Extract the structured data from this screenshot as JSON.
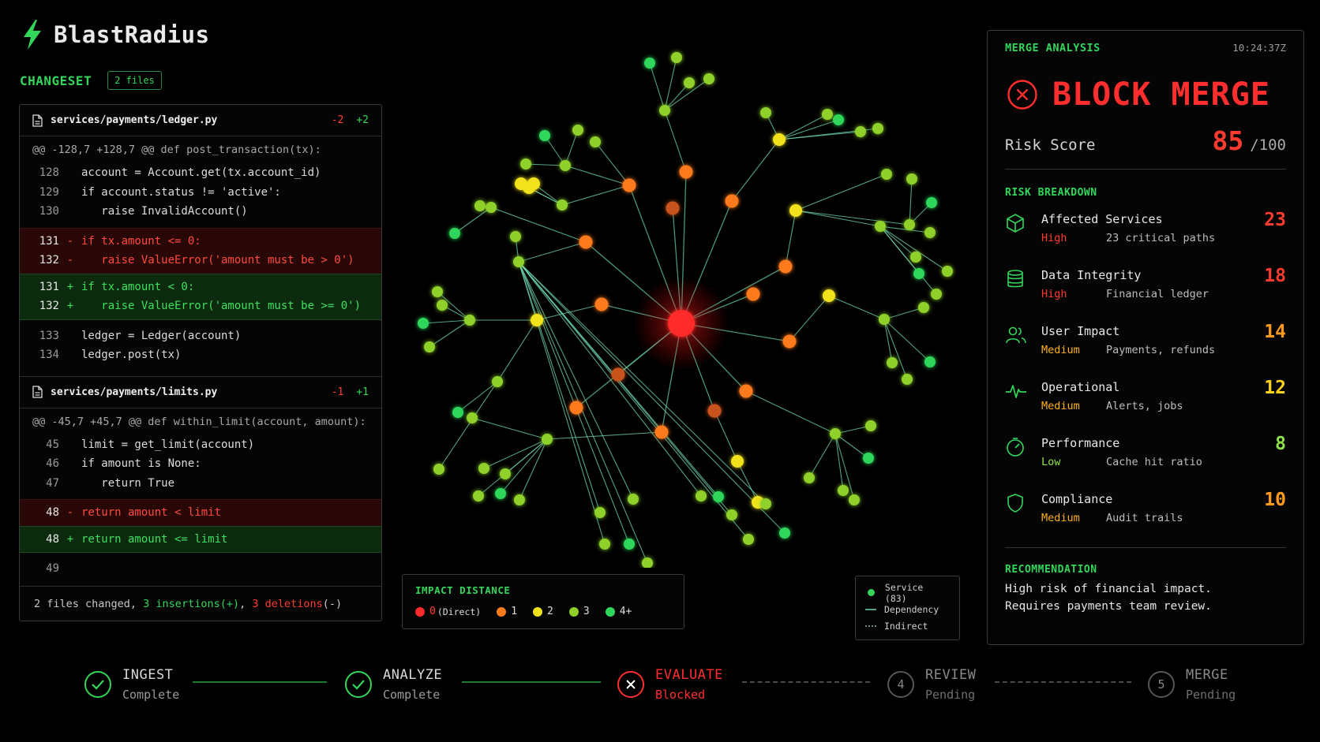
{
  "app": {
    "name": "BlastRadius"
  },
  "changeset": {
    "title": "CHANGESET",
    "badge": "2 files",
    "files": [
      {
        "path": "services/payments/ledger.py",
        "deletions": "-2",
        "insertions": "+2",
        "hunk": "@@ -128,7 +128,7 @@ def post_transaction(tx):",
        "context_before": [
          {
            "ln": "128",
            "code": "account = Account.get(tx.account_id)"
          },
          {
            "ln": "129",
            "code": "if account.status != 'active':"
          },
          {
            "ln": "130",
            "code": "   raise InvalidAccount()"
          }
        ],
        "removed": [
          {
            "ln": "131",
            "mk": "-",
            "code": "if tx.amount <= 0:"
          },
          {
            "ln": "132",
            "mk": "-",
            "code": "   raise ValueError('amount must be > 0')"
          }
        ],
        "added": [
          {
            "ln": "131",
            "mk": "+",
            "code": "if tx.amount < 0:"
          },
          {
            "ln": "132",
            "mk": "+",
            "code": "   raise ValueError('amount must be >= 0')"
          }
        ],
        "context_after": [
          {
            "ln": "133",
            "code": "ledger = Ledger(account)"
          },
          {
            "ln": "134",
            "code": "ledger.post(tx)"
          }
        ]
      },
      {
        "path": "services/payments/limits.py",
        "deletions": "-1",
        "insertions": "+1",
        "hunk": "@@ -45,7 +45,7 @@ def within_limit(account, amount):",
        "context_before": [
          {
            "ln": "45",
            "code": "limit = get_limit(account)"
          },
          {
            "ln": "46",
            "code": "if amount is None:"
          },
          {
            "ln": "47",
            "code": "   return True"
          }
        ],
        "removed": [
          {
            "ln": "48",
            "mk": "-",
            "code": "return amount < limit"
          }
        ],
        "added": [
          {
            "ln": "48",
            "mk": "+",
            "code": "return amount <= limit"
          }
        ],
        "context_after": [
          {
            "ln": "49",
            "code": ""
          }
        ]
      }
    ],
    "footer": {
      "prefix": "2 files changed, ",
      "insertions": "3 insertions(+)",
      "sep": ", ",
      "deletions": "3 deletions",
      "suffix": "(-)"
    }
  },
  "impact_legend": {
    "title": "IMPACT DISTANCE",
    "items": [
      {
        "label": "0",
        "sub": "(Direct)",
        "color": "#ff2a2a"
      },
      {
        "label": "1",
        "sub": "",
        "color": "#ff7a1a"
      },
      {
        "label": "2",
        "sub": "",
        "color": "#f2e21c"
      },
      {
        "label": "3",
        "sub": "",
        "color": "#8fd12a"
      },
      {
        "label": "4+",
        "sub": "",
        "color": "#2fd65a"
      }
    ]
  },
  "node_legend": {
    "service": "Service (83)",
    "dependency": "Dependency",
    "indirect": "Indirect"
  },
  "merge_analysis": {
    "title": "MERGE ANALYSIS",
    "time": "10:24:37Z",
    "verdict": "BLOCK MERGE",
    "risk_label": "Risk Score",
    "risk_score": "85",
    "risk_max": "/100",
    "breakdown_title": "RISK BREAKDOWN",
    "breakdown": [
      {
        "icon": "cube-icon",
        "name": "Affected Services",
        "level": "High",
        "desc": "23 critical paths",
        "score": "23",
        "color": "#ff3b30"
      },
      {
        "icon": "database-icon",
        "name": "Data Integrity",
        "level": "High",
        "desc": "Financial ledger",
        "score": "18",
        "color": "#ff3b30"
      },
      {
        "icon": "users-icon",
        "name": "User Impact",
        "level": "Medium",
        "desc": "Payments, refunds",
        "score": "14",
        "color": "#ff9a1a"
      },
      {
        "icon": "pulse-icon",
        "name": "Operational",
        "level": "Medium",
        "desc": "Alerts, jobs",
        "score": "12",
        "color": "#ffd21a"
      },
      {
        "icon": "gauge-icon",
        "name": "Performance",
        "level": "Low",
        "desc": "Cache hit ratio",
        "score": "8",
        "color": "#8fe04a"
      },
      {
        "icon": "shield-icon",
        "name": "Compliance",
        "level": "Medium",
        "desc": "Audit trails",
        "score": "10",
        "color": "#ff9a1a"
      }
    ],
    "level_colors": {
      "High": "#ff3b30",
      "Medium": "#ffb01a",
      "Low": "#8fe04a"
    },
    "recommendation_title": "RECOMMENDATION",
    "recommendation_line1": "High risk of financial impact.",
    "recommendation_line2": "Requires payments team review."
  },
  "pipeline": [
    {
      "name": "INGEST",
      "status": "Complete",
      "state": "done"
    },
    {
      "name": "ANALYZE",
      "status": "Complete",
      "state": "done"
    },
    {
      "name": "EVALUATE",
      "status": "Blocked",
      "state": "blocked"
    },
    {
      "name": "REVIEW",
      "status": "Pending",
      "state": "pending",
      "num": "4"
    },
    {
      "name": "MERGE",
      "status": "Pending",
      "state": "pending",
      "num": "5"
    }
  ]
}
